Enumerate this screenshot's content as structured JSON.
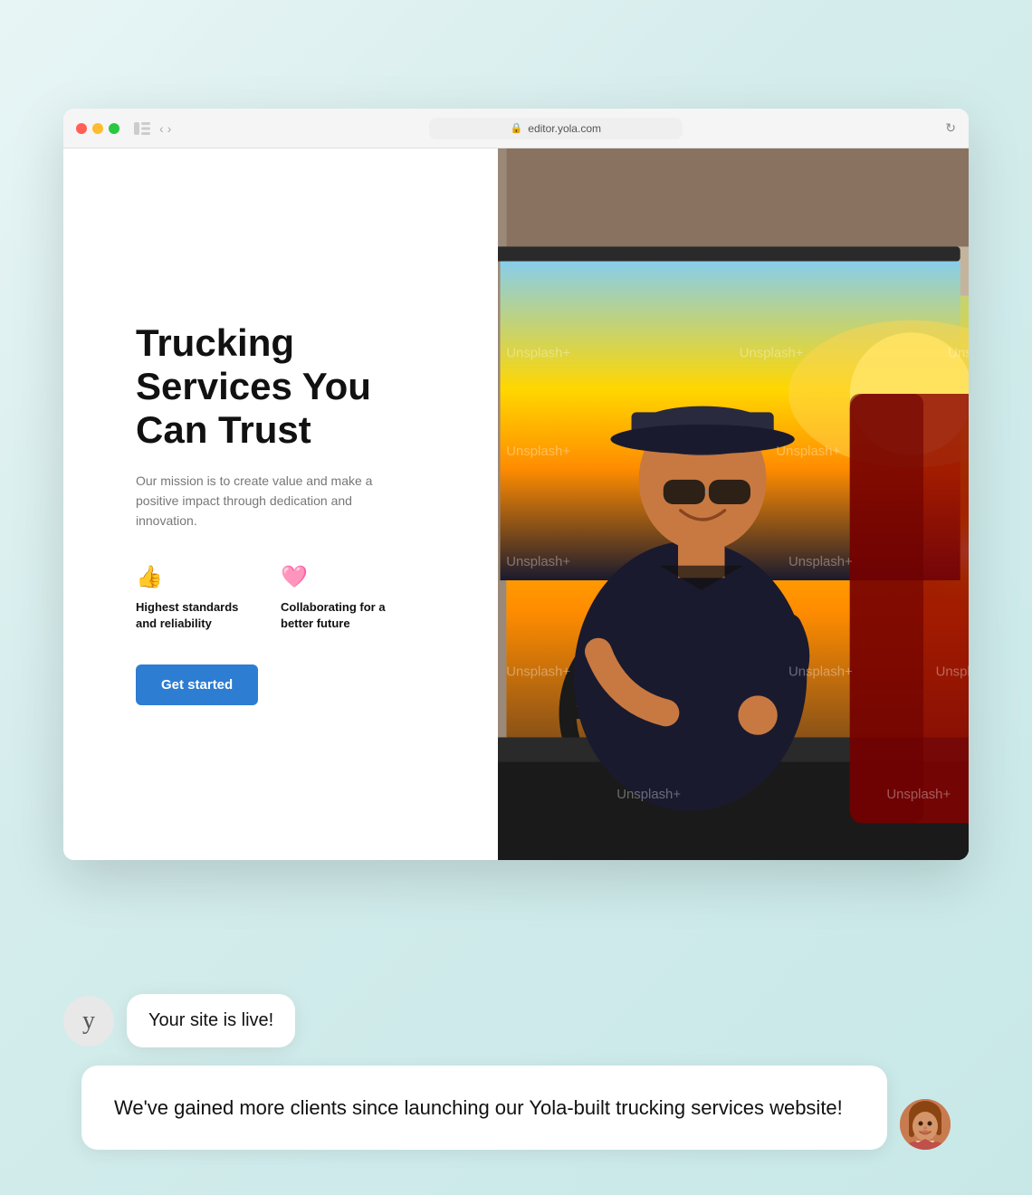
{
  "background": {
    "gradient_start": "#e8f5f5",
    "gradient_end": "#c8e8e8"
  },
  "browser": {
    "url": "editor.yola.com",
    "traffic_lights": [
      "red",
      "yellow",
      "green"
    ]
  },
  "hero": {
    "title": "Trucking Services You Can Trust",
    "subtitle": "Our mission is to create value and make a positive impact through dedication and innovation.",
    "feature1_icon": "👍",
    "feature1_label": "Highest standards and reliability",
    "feature2_icon": "♥",
    "feature2_label": "Collaborating for a better future",
    "cta_button": "Get started"
  },
  "watermark": "Unsplash+",
  "chat": {
    "yola_logo": "y",
    "message1": "Your site is live!",
    "message2": "We've gained more clients since launching our Yola-built trucking services website!"
  }
}
